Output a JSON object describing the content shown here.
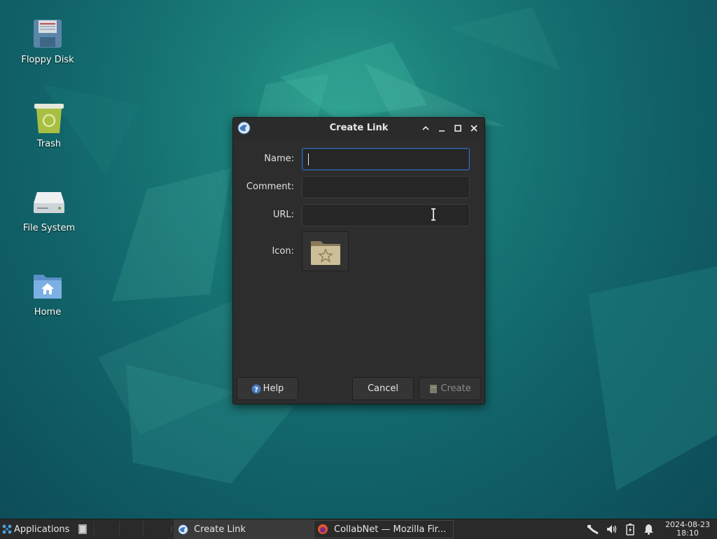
{
  "desktop": {
    "icons": [
      {
        "label": "Floppy Disk"
      },
      {
        "label": "Trash"
      },
      {
        "label": "File System"
      },
      {
        "label": "Home"
      }
    ]
  },
  "dialog": {
    "title": "Create Link",
    "fields": {
      "name_label": "Name:",
      "name_value": "",
      "comment_label": "Comment:",
      "comment_value": "",
      "url_label": "URL:",
      "url_value": "",
      "icon_label": "Icon:"
    },
    "buttons": {
      "help": "Help",
      "cancel": "Cancel",
      "create": "Create"
    }
  },
  "taskbar": {
    "applications_label": "Applications",
    "windows": [
      {
        "label": "Create Link"
      },
      {
        "label": "CollabNet — Mozilla Fir..."
      }
    ],
    "clock": {
      "date": "2024-08-23",
      "time": "18:10"
    }
  },
  "colors": {
    "desktop_bg": "#136a6d",
    "dialog_bg": "#2d2d2d",
    "focus_border": "#3a6aa8",
    "taskbar_bg": "#2a2a2a"
  }
}
